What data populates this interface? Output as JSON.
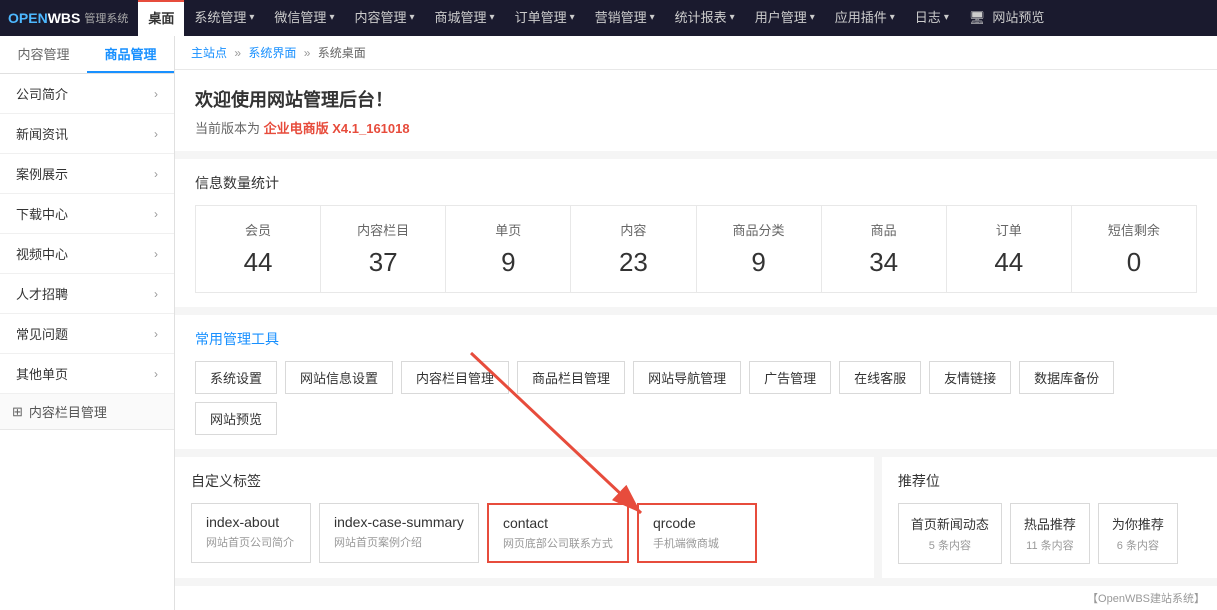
{
  "logo": {
    "open": "OPEN",
    "wbs": "WBS",
    "sub": "管理系统"
  },
  "topnav": {
    "items": [
      {
        "label": "桌面",
        "active": true,
        "has_arrow": false
      },
      {
        "label": "系统管理",
        "active": false,
        "has_arrow": true
      },
      {
        "label": "微信管理",
        "active": false,
        "has_arrow": true
      },
      {
        "label": "内容管理",
        "active": false,
        "has_arrow": true
      },
      {
        "label": "商城管理",
        "active": false,
        "has_arrow": true
      },
      {
        "label": "订单管理",
        "active": false,
        "has_arrow": true
      },
      {
        "label": "营销管理",
        "active": false,
        "has_arrow": true
      },
      {
        "label": "统计报表",
        "active": false,
        "has_arrow": true
      },
      {
        "label": "用户管理",
        "active": false,
        "has_arrow": true
      },
      {
        "label": "应用插件",
        "active": false,
        "has_arrow": true
      },
      {
        "label": "日志",
        "active": false,
        "has_arrow": true
      },
      {
        "label": "网站预览",
        "active": false,
        "has_arrow": false,
        "has_monitor": true
      }
    ]
  },
  "sidebar": {
    "tabs": [
      {
        "label": "内容管理",
        "active": false
      },
      {
        "label": "商品管理",
        "active": true
      }
    ],
    "menu_items": [
      {
        "label": "公司简介"
      },
      {
        "label": "新闻资讯"
      },
      {
        "label": "案例展示"
      },
      {
        "label": "下载中心"
      },
      {
        "label": "视频中心"
      },
      {
        "label": "人才招聘"
      },
      {
        "label": "常见问题"
      },
      {
        "label": "其他单页"
      }
    ],
    "section_label": "内容栏目管理"
  },
  "breadcrumb": {
    "items": [
      "主站点",
      "系统界面",
      "系统桌面"
    ],
    "separator": "»"
  },
  "welcome": {
    "title": "欢迎使用网站管理后台！",
    "sub_prefix": "当前版本为 ",
    "version": "企业电商版 X4.1_161018"
  },
  "stats": {
    "section_title": "信息数量统计",
    "items": [
      {
        "label": "会员",
        "value": "44"
      },
      {
        "label": "内容栏目",
        "value": "37"
      },
      {
        "label": "单页",
        "value": "9"
      },
      {
        "label": "内容",
        "value": "23"
      },
      {
        "label": "商品分类",
        "value": "9"
      },
      {
        "label": "商品",
        "value": "34"
      },
      {
        "label": "订单",
        "value": "44"
      },
      {
        "label": "短信剩余",
        "value": "0"
      }
    ]
  },
  "tools": {
    "section_title": "常用管理工具",
    "items": [
      "系统设置",
      "网站信息设置",
      "内容栏目管理",
      "商品栏目管理",
      "网站导航管理",
      "广告管理",
      "在线客服",
      "友情链接",
      "数据库备份",
      "网站预览"
    ]
  },
  "custom_tags": {
    "section_title": "自定义标签",
    "items": [
      {
        "name": "index-about",
        "desc": "网站首页公司简介"
      },
      {
        "name": "index-case-summary",
        "desc": "网站首页案例介绍"
      },
      {
        "name": "contact",
        "desc": "网页底部公司联系方式",
        "highlighted": true
      },
      {
        "name": "qrcode",
        "desc": "手机端微商城",
        "highlighted": true
      }
    ]
  },
  "recommended": {
    "section_title": "推荐位",
    "items": [
      {
        "name": "首页新闻动态",
        "count": "5 条内容"
      },
      {
        "name": "热品推荐",
        "count": "11 条内容"
      },
      {
        "name": "为你推荐",
        "count": "6 条内容"
      }
    ]
  },
  "bottom_info": "【OpenWBS建站系统】"
}
